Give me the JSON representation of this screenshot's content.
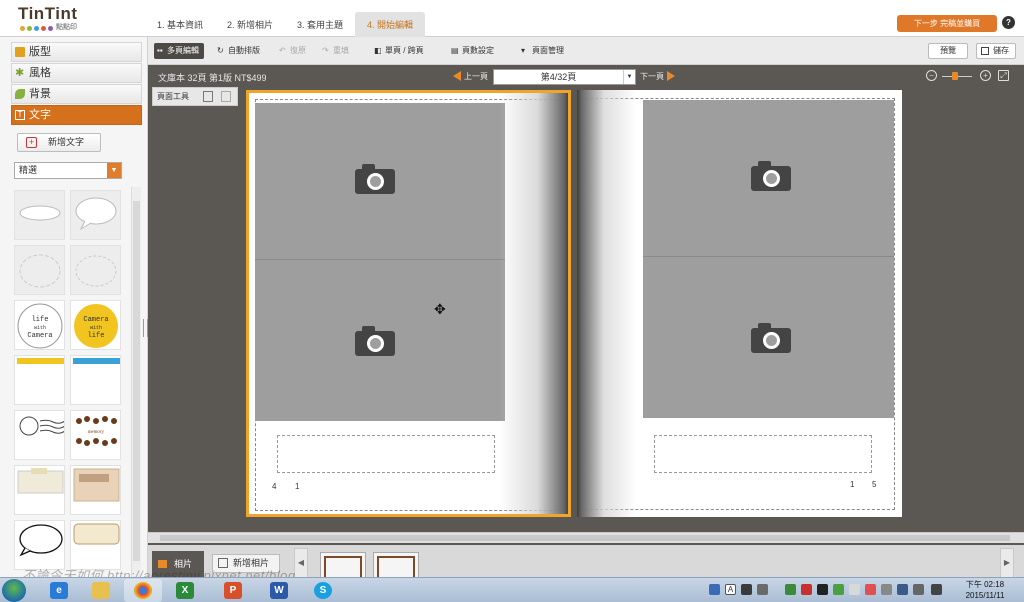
{
  "header": {
    "logo_text": "TinTint",
    "logo_sub": "點點印",
    "steps": [
      {
        "label": "1. 基本資訊"
      },
      {
        "label": "2. 新增相片"
      },
      {
        "label": "3. 套用主題"
      },
      {
        "label": "4. 開始編輯"
      }
    ],
    "next_button": "下一步 完稿並購買",
    "help": "?"
  },
  "left_panel": {
    "categories": [
      {
        "label": "版型"
      },
      {
        "label": "風格"
      },
      {
        "label": "背景"
      },
      {
        "label": "文字"
      }
    ],
    "add_text_button": "新增文字",
    "filter_select": "精選",
    "stickers": {
      "life_with_camera": "life with Camera",
      "camera_with_life": "Camera with life",
      "memory": "memory"
    }
  },
  "toolbar": {
    "multi_page": "多頁編輯",
    "auto_layout": "自動排版",
    "undo": "復原",
    "redo": "重填",
    "single_double": "單頁 / 跨頁",
    "page_settings": "頁數設定",
    "page_manage": "頁面管理",
    "preview": "預覽",
    "save": "儲存"
  },
  "canvas": {
    "book_info": "文庫本 32頁 第1版 NT$499",
    "prev_page": "上一頁",
    "next_page": "下一頁",
    "page_select": "第4/32頁",
    "page_tools": "頁面工具",
    "left_page_numbers": [
      "4",
      "1"
    ],
    "right_page_numbers": [
      "1",
      "5"
    ]
  },
  "filmstrip": {
    "photos_tab": "相片",
    "add_photo": "新增相片"
  },
  "watermark": "不論今天如何 http://aorestiny.pixnet.net/blog",
  "taskbar": {
    "clock_time": "下午 02:18",
    "clock_date": "2015/11/11",
    "tray_keyboard": "A"
  },
  "colors": {
    "accent": "#e07c2c",
    "canvas_bg": "#5b5753",
    "selected_page_border": "#f0a52a",
    "photo_placeholder": "#9e9e9e"
  }
}
